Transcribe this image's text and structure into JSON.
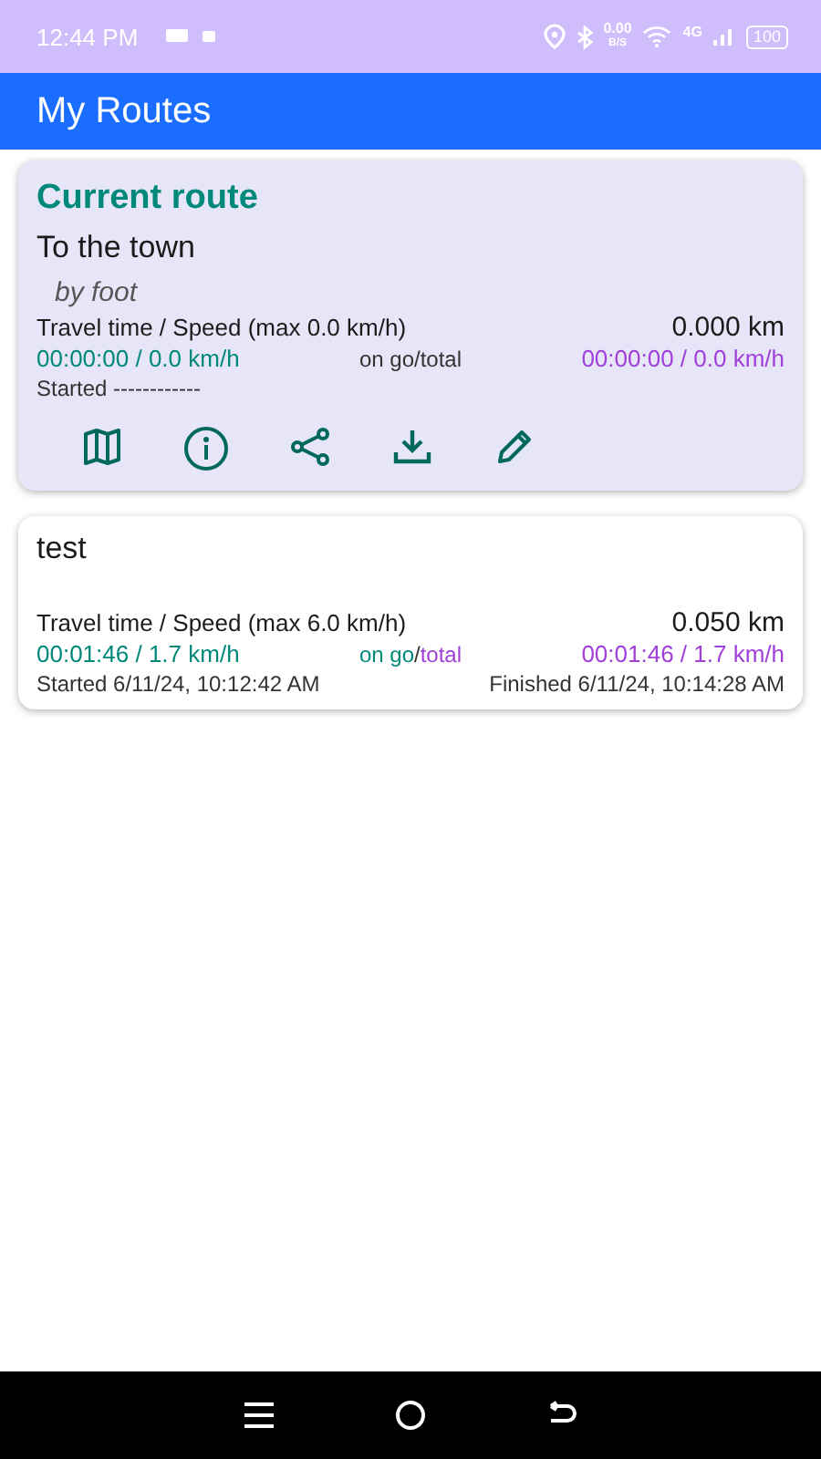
{
  "status_bar": {
    "time": "12:44 PM",
    "net_speed": "0.00",
    "net_unit": "B/S",
    "network": "4G",
    "battery": "100"
  },
  "app_bar": {
    "title": "My Routes"
  },
  "current": {
    "heading": "Current route",
    "name": "To the town",
    "mode": "by foot",
    "stats_label": "Travel time / Speed (max 0.0 km/h)",
    "distance": "0.000 km",
    "on_go": "00:00:00 / 0.0 km/h",
    "legend": {
      "on_go": "on go",
      "sep": "/",
      "total": "total",
      "colored": false
    },
    "total": "00:00:00 / 0.0 km/h",
    "started": "Started ------------",
    "actions": [
      {
        "kind": "map"
      },
      {
        "kind": "info"
      },
      {
        "kind": "share"
      },
      {
        "kind": "download"
      },
      {
        "kind": "edit"
      }
    ]
  },
  "routes": [
    {
      "name": "test",
      "stats_label": "Travel time / Speed (max 6.0 km/h)",
      "distance": "0.050 km",
      "on_go": "00:01:46 / 1.7 km/h",
      "legend": {
        "on_go": "on go",
        "sep": "/",
        "total": "total",
        "colored": true
      },
      "total": "00:01:46 / 1.7 km/h",
      "started": "Started 6/11/24, 10:12:42 AM",
      "finished": "Finished 6/11/24, 10:14:28 AM"
    }
  ]
}
